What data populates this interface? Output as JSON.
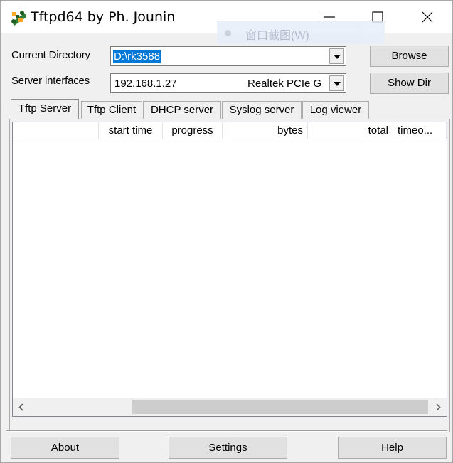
{
  "window": {
    "title": "Tftpd64 by Ph. Jounin",
    "icon": "tftpd64-app-icon"
  },
  "snip_overlay": {
    "text": "窗口截图(W)"
  },
  "fields": {
    "current_directory_label": "Current Directory",
    "current_directory_value": "D:\\rk3588",
    "server_interfaces_label": "Server interfaces",
    "server_interface_ip": "192.168.1.27",
    "server_interface_name": "Realtek PCIe G"
  },
  "buttons": {
    "browse": {
      "mnemonic": "B",
      "rest": "rowse"
    },
    "show_dir": {
      "before": "Show ",
      "mnemonic": "D",
      "rest": "ir"
    },
    "about": {
      "mnemonic": "A",
      "rest": "bout"
    },
    "settings": {
      "mnemonic": "S",
      "rest": "ettings"
    },
    "help": {
      "mnemonic": "H",
      "rest": "elp"
    }
  },
  "tabs": [
    {
      "label": "Tftp Server",
      "active": true
    },
    {
      "label": "Tftp Client",
      "active": false
    },
    {
      "label": "DHCP server",
      "active": false
    },
    {
      "label": "Syslog server",
      "active": false
    },
    {
      "label": "Log viewer",
      "active": false
    }
  ],
  "table": {
    "columns": [
      "",
      "start time",
      "progress",
      "bytes",
      "total",
      "timeo..."
    ],
    "rows": []
  },
  "colors": {
    "selection": "#0078d7",
    "window_bg": "#f0f0f0"
  }
}
